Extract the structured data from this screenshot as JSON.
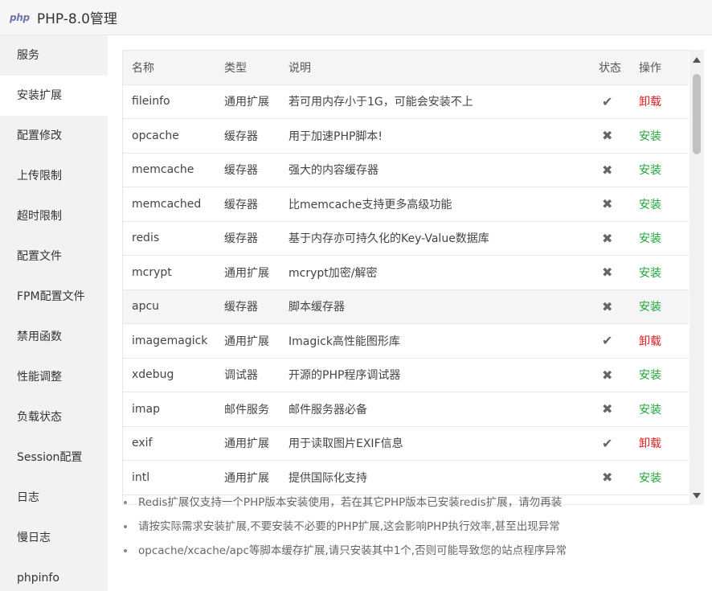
{
  "window": {
    "logo_text": "php",
    "title": "PHP-8.0管理"
  },
  "sidebar": {
    "items": [
      {
        "label": "服务",
        "active": false
      },
      {
        "label": "安装扩展",
        "active": true
      },
      {
        "label": "配置修改",
        "active": false
      },
      {
        "label": "上传限制",
        "active": false
      },
      {
        "label": "超时限制",
        "active": false
      },
      {
        "label": "配置文件",
        "active": false
      },
      {
        "label": "FPM配置文件",
        "active": false
      },
      {
        "label": "禁用函数",
        "active": false
      },
      {
        "label": "性能调整",
        "active": false
      },
      {
        "label": "负载状态",
        "active": false
      },
      {
        "label": "Session配置",
        "active": false
      },
      {
        "label": "日志",
        "active": false
      },
      {
        "label": "慢日志",
        "active": false
      },
      {
        "label": "phpinfo",
        "active": false
      }
    ]
  },
  "table": {
    "headers": {
      "name": "名称",
      "type": "类型",
      "desc": "说明",
      "status": "状态",
      "action": "操作"
    },
    "rows": [
      {
        "name": "fileinfo",
        "type": "通用扩展",
        "desc": "若可用内存小于1G，可能会安装不上",
        "installed": true,
        "action": "卸载"
      },
      {
        "name": "opcache",
        "type": "缓存器",
        "desc": "用于加速PHP脚本!",
        "installed": false,
        "action": "安装"
      },
      {
        "name": "memcache",
        "type": "缓存器",
        "desc": "强大的内容缓存器",
        "installed": false,
        "action": "安装"
      },
      {
        "name": "memcached",
        "type": "缓存器",
        "desc": "比memcache支持更多高级功能",
        "installed": false,
        "action": "安装"
      },
      {
        "name": "redis",
        "type": "缓存器",
        "desc": "基于内存亦可持久化的Key-Value数据库",
        "installed": false,
        "action": "安装"
      },
      {
        "name": "mcrypt",
        "type": "通用扩展",
        "desc": "mcrypt加密/解密",
        "installed": false,
        "action": "安装"
      },
      {
        "name": "apcu",
        "type": "缓存器",
        "desc": "脚本缓存器",
        "installed": false,
        "action": "安装",
        "highlight": true
      },
      {
        "name": "imagemagick",
        "type": "通用扩展",
        "desc": "Imagick高性能图形库",
        "installed": true,
        "action": "卸载"
      },
      {
        "name": "xdebug",
        "type": "调试器",
        "desc": "开源的PHP程序调试器",
        "installed": false,
        "action": "安装"
      },
      {
        "name": "imap",
        "type": "邮件服务",
        "desc": "邮件服务器必备",
        "installed": false,
        "action": "安装"
      },
      {
        "name": "exif",
        "type": "通用扩展",
        "desc": "用于读取图片EXIF信息",
        "installed": true,
        "action": "卸载"
      },
      {
        "name": "intl",
        "type": "通用扩展",
        "desc": "提供国际化支持",
        "installed": false,
        "action": "安装"
      }
    ]
  },
  "notes": [
    "Redis扩展仅支持一个PHP版本安装使用，若在其它PHP版本已安装redis扩展，请勿再装",
    "请按实际需求安装扩展,不要安装不必要的PHP扩展,这会影响PHP执行效率,甚至出现异常",
    "opcache/xcache/apc等脚本缓存扩展,请只安装其中1个,否则可能导致您的站点程序异常"
  ],
  "colors": {
    "uninstall": "#e02020",
    "install": "#20a53a",
    "sidebar_bg": "#f2f2f2",
    "header_bg": "#f5f5f5"
  },
  "icons": {
    "installed": "check-icon",
    "not_installed": "cross-icon"
  }
}
